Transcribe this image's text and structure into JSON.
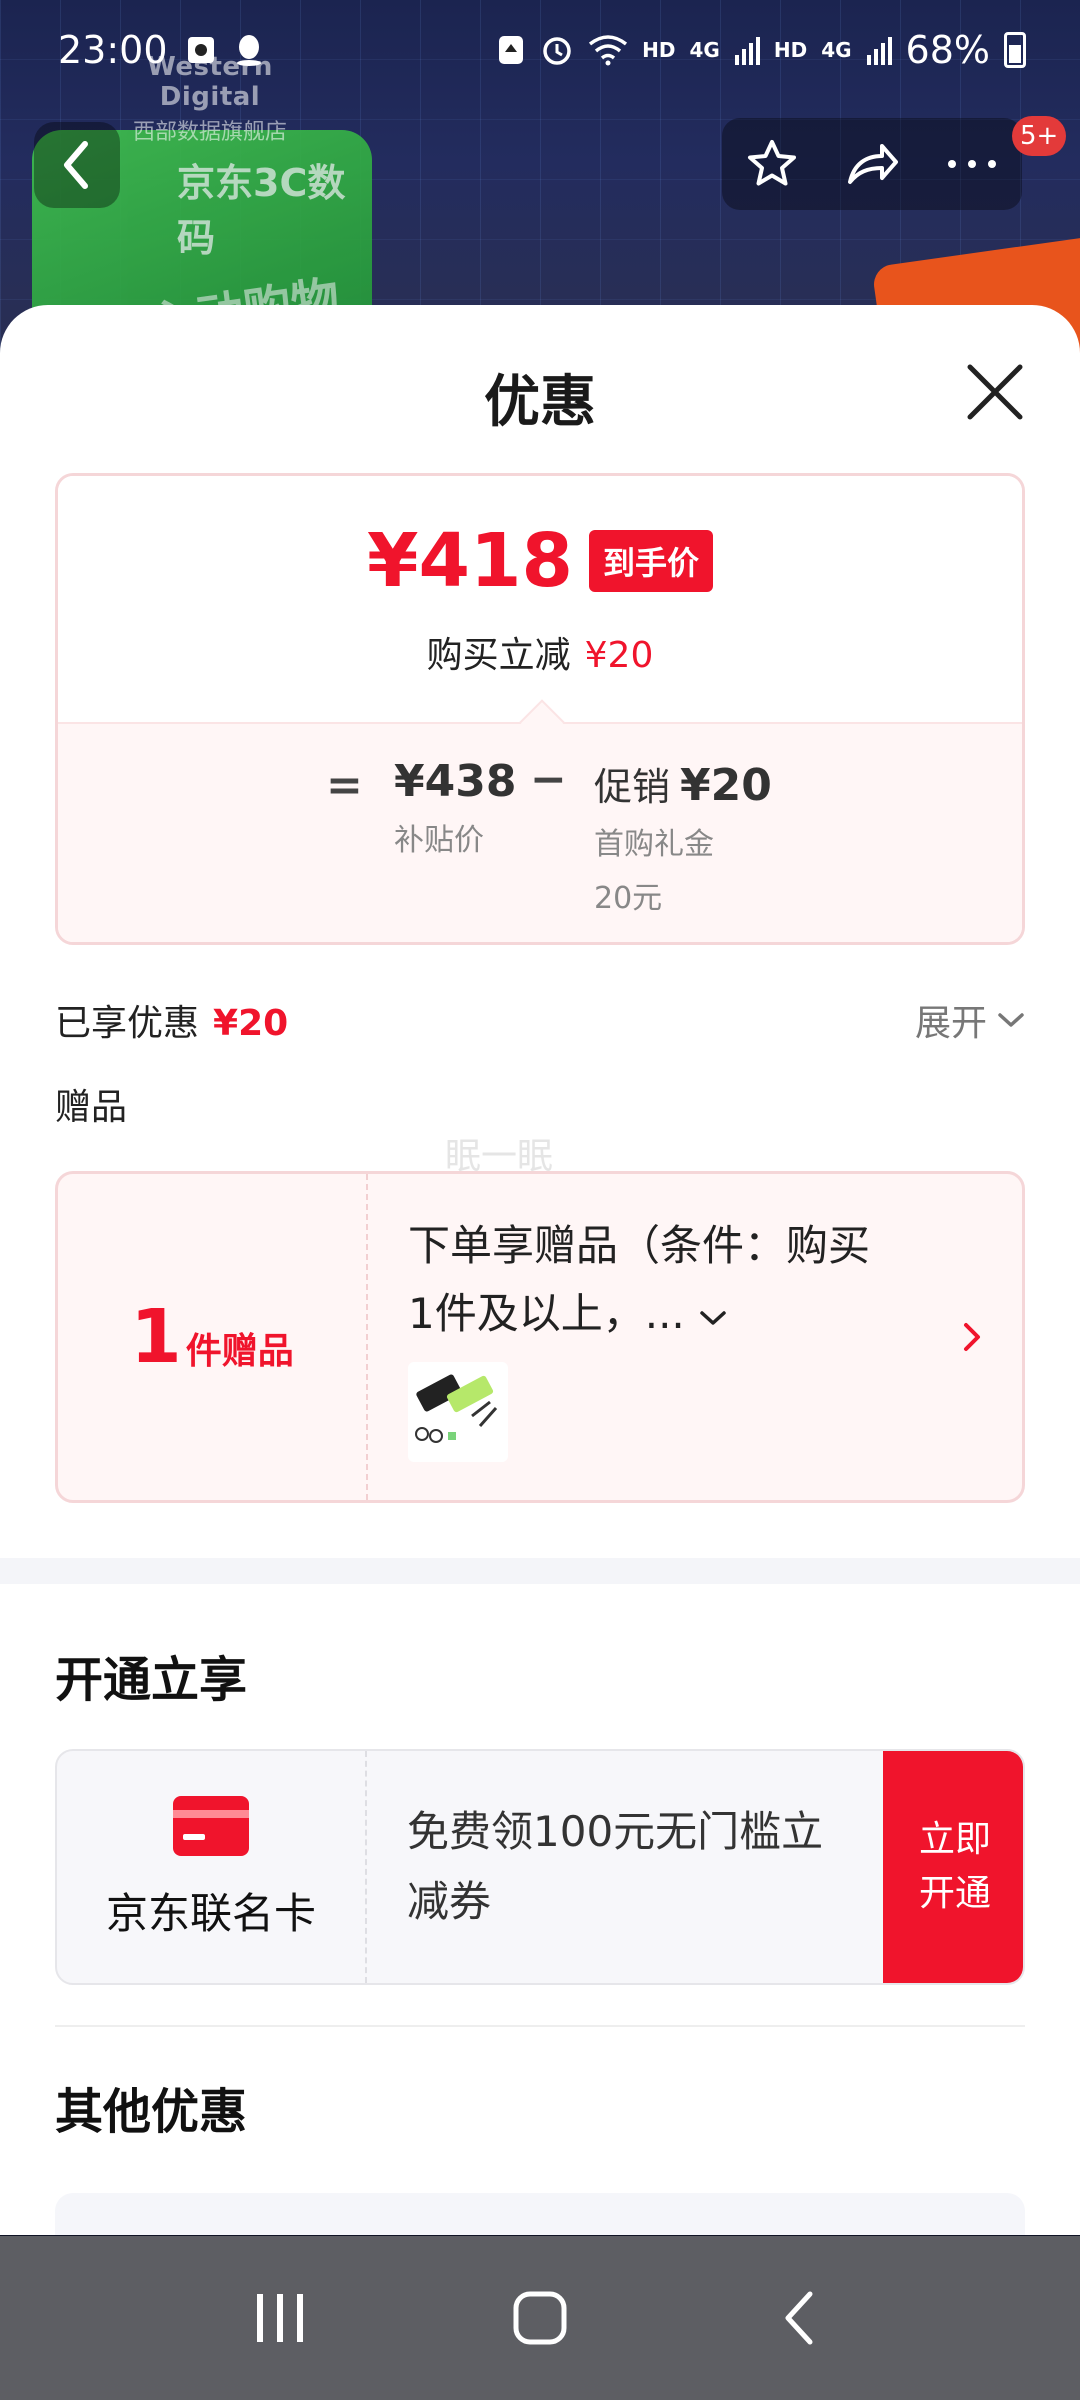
{
  "status_bar": {
    "time": "23:00",
    "hd1": "HD",
    "net1": "4G",
    "hd2": "HD",
    "net2": "4G",
    "battery": "68%"
  },
  "background_page": {
    "store_logo": "Western Digital",
    "store_name": "西部数据旗舰店",
    "banner_title": "京东3C数码",
    "banner_sub": "心动购物季",
    "cart_badge": "5+"
  },
  "sheet": {
    "title": "优惠",
    "price_card": {
      "final_price": "¥418",
      "final_tag": "到手价",
      "reduce_label": "购买立减",
      "reduce_value": "¥20",
      "eq": "=",
      "minus": "−",
      "base_price": "¥438",
      "base_label": "补贴价",
      "promo_label": "促销",
      "promo_value": "¥20",
      "promo_desc": "首购礼金",
      "promo_desc_value": "20元"
    },
    "enjoyed": {
      "label": "已享优惠",
      "value": "¥20",
      "expand": "展开"
    },
    "gift": {
      "section_label": "赠品",
      "watermark": "眠一眠",
      "count": "1",
      "count_unit": "件赠品",
      "desc_line1": "下单享赠品（条件：购买",
      "desc_line2": "1件及以上，..."
    },
    "open_section": {
      "title": "开通立享",
      "card_name": "京东联名卡",
      "desc_line1": "免费领100元无门槛立",
      "desc_line2": "减券",
      "btn_line1": "立即",
      "btn_line2": "开通"
    },
    "other_section": {
      "title": "其他优惠"
    }
  },
  "colors": {
    "accent_red": "#f0142c",
    "card_pink": "#fff6f6",
    "nav_gray": "#5d5e63"
  }
}
